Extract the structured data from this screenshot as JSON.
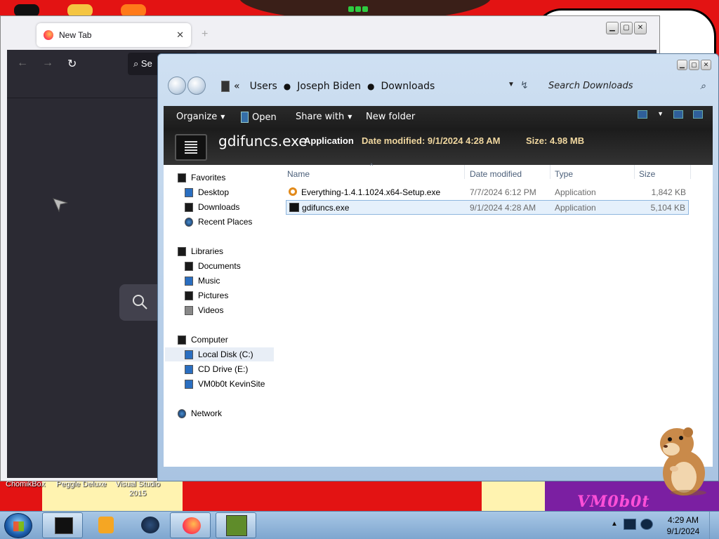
{
  "browser": {
    "tab_title": "New Tab",
    "tab_close": "✕",
    "new_tab": "+",
    "search_fragment": "Se"
  },
  "explorer": {
    "breadcrumb": [
      "Users",
      "Joseph Biden",
      "Downloads"
    ],
    "breadcrumb_prefix": "«",
    "search_placeholder": "Search Downloads",
    "toolbar": {
      "organize": "Organize",
      "open": "Open",
      "share_with": "Share with",
      "new_folder": "New folder"
    },
    "details": {
      "name": "gdifuncs.exe",
      "type": "Application",
      "date_modified": "Date modified: 9/1/2024 4:28 AM",
      "size": "Size: 4.98 MB"
    },
    "nav": {
      "favorites": {
        "label": "Favorites",
        "items": [
          "Desktop",
          "Downloads",
          "Recent Places"
        ]
      },
      "libraries": {
        "label": "Libraries",
        "items": [
          "Documents",
          "Music",
          "Pictures",
          "Videos"
        ]
      },
      "computer": {
        "label": "Computer",
        "items": [
          "Local Disk (C:)",
          "CD Drive (E:)",
          "VM0b0t KevinSite"
        ]
      },
      "network": {
        "label": "Network"
      }
    },
    "columns": [
      "Name",
      "Date modified",
      "Type",
      "Size"
    ],
    "files": [
      {
        "name": "Everything-1.4.1.1024.x64-Setup.exe",
        "date": "7/7/2024 6:12 PM",
        "type": "Application",
        "size": "1,842 KB",
        "icon": "search-icon"
      },
      {
        "name": "gdifuncs.exe",
        "date": "9/1/2024 4:28 AM",
        "type": "Application",
        "size": "5,104 KB",
        "icon": "app-icon",
        "selected": true
      }
    ]
  },
  "desktop": {
    "icons": [
      "ChomikBox",
      "Peggle Deluxe",
      "Visual Studio 2015"
    ],
    "graffiti": "VM0b0t"
  },
  "taskbar": {
    "time": "4:29 AM",
    "date": "9/1/2024"
  }
}
